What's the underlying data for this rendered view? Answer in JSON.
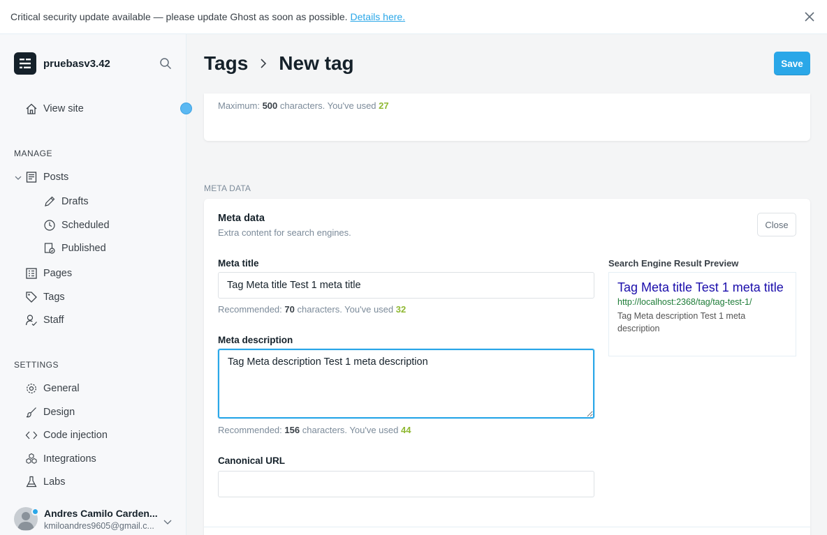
{
  "banner": {
    "text": "Critical security update available — please update Ghost as soon as possible.",
    "link": "Details here."
  },
  "sidebar": {
    "site_name": "pruebasv3.42",
    "view_site": "View site",
    "manage_title": "MANAGE",
    "posts": "Posts",
    "drafts": "Drafts",
    "scheduled": "Scheduled",
    "published": "Published",
    "pages": "Pages",
    "tags": "Tags",
    "staff": "Staff",
    "settings_title": "SETTINGS",
    "general": "General",
    "design": "Design",
    "code_injection": "Code injection",
    "integrations": "Integrations",
    "labs": "Labs",
    "user_name": "Andres Camilo Carden...",
    "user_email": "kmiloandres9605@gmail.c..."
  },
  "header": {
    "crumb_parent": "Tags",
    "crumb_current": "New tag",
    "save_label": "Save"
  },
  "description_hint": {
    "prefix": "Maximum:",
    "limit": "500",
    "middle": "characters. You've used",
    "used": "27"
  },
  "meta_section_label": "META DATA",
  "meta": {
    "title": "Meta data",
    "subtitle": "Extra content for search engines.",
    "close_label": "Close",
    "meta_title_label": "Meta title",
    "meta_title_value": "Tag Meta title Test 1 meta title",
    "meta_title_hint": {
      "prefix": "Recommended:",
      "limit": "70",
      "middle": "characters. You've used",
      "used": "32"
    },
    "meta_desc_label": "Meta description",
    "meta_desc_value": "Tag Meta description Test 1 meta description",
    "meta_desc_hint": {
      "prefix": "Recommended:",
      "limit": "156",
      "middle": "characters. You've used",
      "used": "44"
    },
    "canonical_label": "Canonical URL",
    "canonical_value": ""
  },
  "serp": {
    "label": "Search Engine Result Preview",
    "title": "Tag Meta title Test 1 meta title",
    "url": "http://localhost:2368/tag/tag-test-1/",
    "description": "Tag Meta description Test 1 meta description"
  },
  "colors": {
    "accent": "#2aa7e8",
    "count_ok": "#8fb832",
    "serp_title": "#1a0dab",
    "serp_url": "#1e7c38"
  }
}
